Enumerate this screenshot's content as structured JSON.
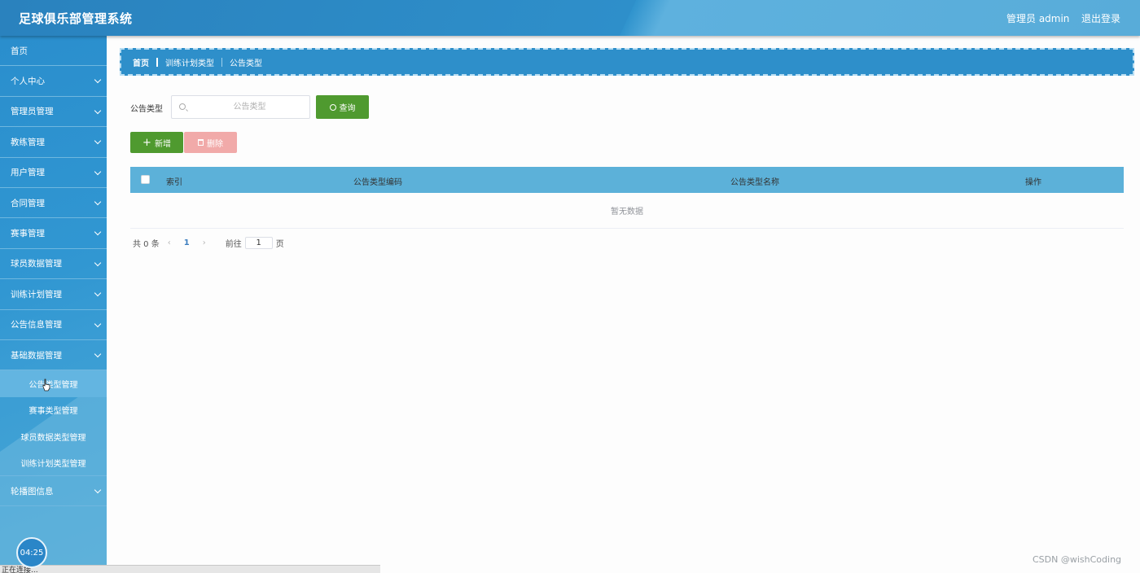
{
  "header": {
    "title": "足球俱乐部管理系统",
    "user": "管理员 admin",
    "logout": "退出登录"
  },
  "sidebar": {
    "items": [
      {
        "label": "首页",
        "expandable": false
      },
      {
        "label": "个人中心",
        "expandable": true
      },
      {
        "label": "管理员管理",
        "expandable": true
      },
      {
        "label": "教练管理",
        "expandable": true
      },
      {
        "label": "用户管理",
        "expandable": true
      },
      {
        "label": "合同管理",
        "expandable": true
      },
      {
        "label": "赛事管理",
        "expandable": true
      },
      {
        "label": "球员数据管理",
        "expandable": true
      },
      {
        "label": "训练计划管理",
        "expandable": true
      },
      {
        "label": "公告信息管理",
        "expandable": true
      },
      {
        "label": "基础数据管理",
        "expandable": true
      },
      {
        "label": "轮播图信息",
        "expandable": true
      }
    ],
    "submenu": [
      {
        "label": "公告类型管理",
        "active": true
      },
      {
        "label": "赛事类型管理",
        "active": false
      },
      {
        "label": "球员数据类型管理",
        "active": false
      },
      {
        "label": "训练计划类型管理",
        "active": false
      }
    ],
    "clock": "04:25"
  },
  "breadcrumb": [
    "首页",
    "训练计划类型",
    "公告类型"
  ],
  "search": {
    "label": "公告类型",
    "placeholder": "公告类型",
    "value": "",
    "query_button": "查询"
  },
  "actions": {
    "add": "新增",
    "delete": "删除"
  },
  "table": {
    "columns": [
      "索引",
      "公告类型编码",
      "公告类型名称",
      "操作"
    ],
    "rows": [],
    "empty_text": "暂无数据"
  },
  "pagination": {
    "total_text": "共 0 条",
    "current_page": "1",
    "goto_label": "前往",
    "goto_value": "1",
    "page_unit": "页"
  },
  "watermark": "CSDN @wishCoding",
  "status_bar": "正在连接..."
}
